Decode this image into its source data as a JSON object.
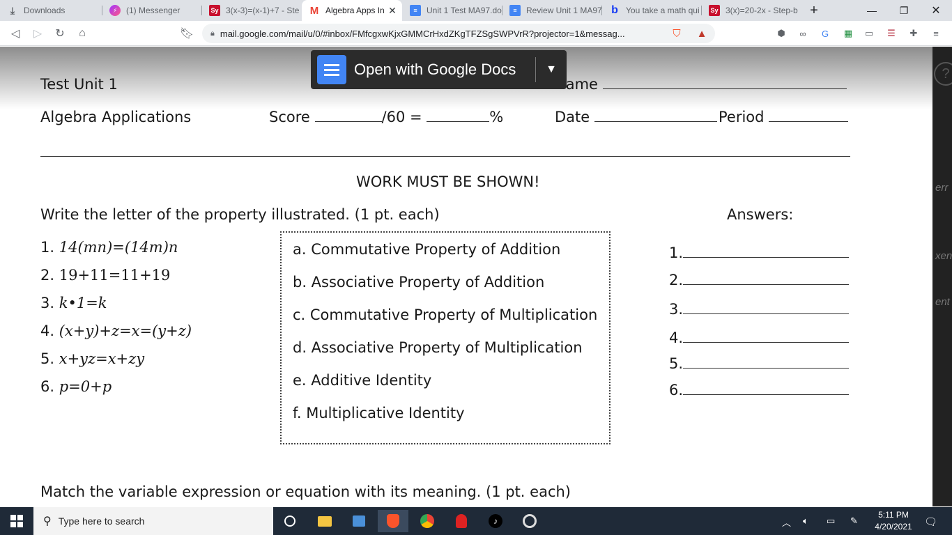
{
  "tabs": [
    {
      "title": "Downloads",
      "icon": "download-icon"
    },
    {
      "title": "(1) Messenger",
      "icon": "messenger-icon"
    },
    {
      "title": "3(x-3)=(x-1)+7 - Ste",
      "icon": "symbolab-icon"
    },
    {
      "title": "Algebra Apps In",
      "icon": "gmail-icon",
      "active": true
    },
    {
      "title": "Unit 1 Test MA97.do",
      "icon": "docs-icon"
    },
    {
      "title": "Review Unit 1 MA97",
      "icon": "docs-icon"
    },
    {
      "title": "You take a math qui",
      "icon": "brainly-icon"
    },
    {
      "title": "3(x)=20-2x - Step-b",
      "icon": "symbolab-icon"
    }
  ],
  "colors": {
    "symbolab": "#c8102e",
    "gmail": "#ea4335",
    "docs": "#4285f4",
    "brave": "#fb542b"
  },
  "address": {
    "url": "mail.google.com/mail/u/0/#inbox/FMfcgxwKjxGMMCrHxdZKgTFZSgSWPVrR?projector=1&messag..."
  },
  "viewer": {
    "open_with_label": "Open with Google Docs"
  },
  "doc": {
    "test_title": "Test Unit 1",
    "name_label": "Name",
    "course": "Algebra Applications",
    "score_label": "Score",
    "score_denominator": "/60 =",
    "percent_sign": "%",
    "date_label": "Date",
    "period_label": "Period",
    "heading": "WORK MUST BE SHOWN!",
    "instructions1": "Write the letter of the property illustrated.  (1 pt. each)",
    "answers_label": "Answers:",
    "problems": [
      {
        "num": "1.",
        "expr": "14(mn)=(14m)n"
      },
      {
        "num": "2.",
        "expr": "19+11=11+19"
      },
      {
        "num": "3.",
        "expr": "k•1=k"
      },
      {
        "num": "4.",
        "expr": "(x+y)+z=x=(y+z)"
      },
      {
        "num": "5.",
        "expr": "x+yz=x+zy"
      },
      {
        "num": "6.",
        "expr": "p=0+p"
      }
    ],
    "properties": [
      "a.  Commutative Property of Addition",
      "b.  Associative Property of Addition",
      "c.  Commutative Property of Multiplication",
      "d.  Associative Property of Multiplication",
      "e.  Additive Identity",
      "f.  Multiplicative Identity"
    ],
    "answer_nums": [
      "1.",
      "2.",
      "3.",
      "4.",
      "5.",
      "6."
    ],
    "instructions2": "Match the variable expression or equation with its meaning.  (1 pt. each)"
  },
  "side_fragments": [
    "err",
    "xen",
    "ent"
  ],
  "taskbar": {
    "search_placeholder": "Type here to search",
    "time": "5:11 PM",
    "date": "4/20/2021"
  }
}
